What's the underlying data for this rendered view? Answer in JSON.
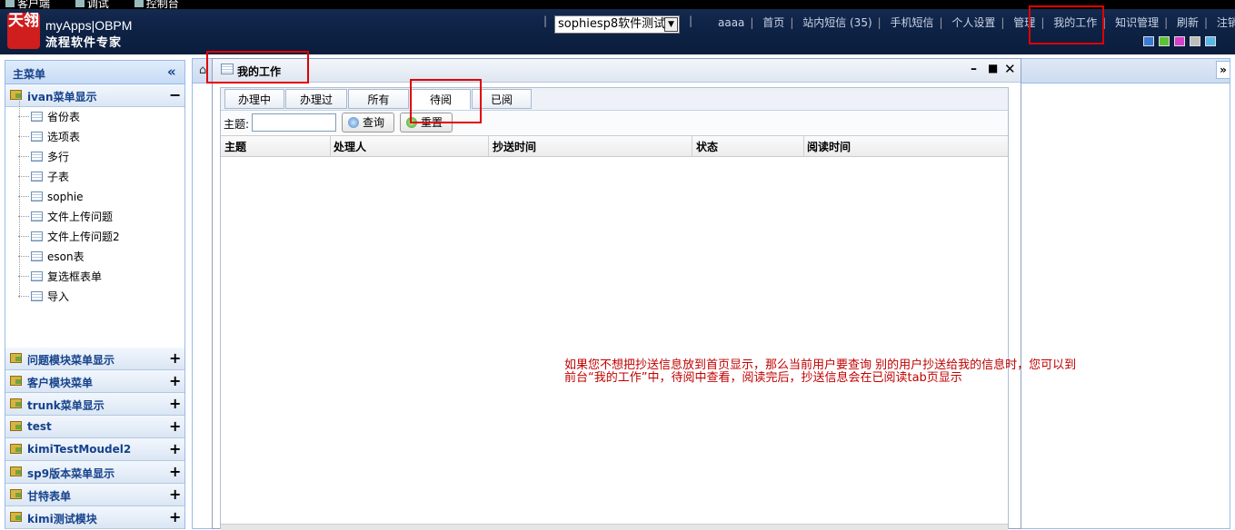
{
  "topbar": {
    "items": [
      "客户端",
      "调试",
      "控制台"
    ]
  },
  "brand": {
    "logo_mark": "天翎",
    "name": "myApps|OBPM",
    "tagline": "流程软件专家"
  },
  "app_select": {
    "value": "sophiesp8软件测试"
  },
  "nav": {
    "user": "aaaa",
    "items": [
      "首页",
      "站内短信 (35)",
      "手机短信",
      "个人设置",
      "管理",
      "我的工作",
      "知识管理",
      "刷新",
      "注销"
    ]
  },
  "theme_colors": [
    "#3a7bd5",
    "#5bc236",
    "#d63fc8",
    "#bdbdbd",
    "#5ab6e8"
  ],
  "sidebar": {
    "title": "主菜单",
    "collapse_glyph": "«",
    "open_group": {
      "label": "ivan菜单显示",
      "toggle": "−",
      "items": [
        "省份表",
        "选项表",
        "多行",
        "子表",
        "sophie",
        "文件上传问题",
        "文件上传问题2",
        "eson表",
        "复选框表单",
        "导入"
      ]
    },
    "groups": [
      {
        "label": "问题模块菜单显示",
        "toggle": "+"
      },
      {
        "label": "客户模块菜单",
        "toggle": "+"
      },
      {
        "label": "trunk菜单显示",
        "toggle": "+"
      },
      {
        "label": "test",
        "toggle": "+"
      },
      {
        "label": "kimiTestMoudel2",
        "toggle": "+"
      },
      {
        "label": "sp9版本菜单显示",
        "toggle": "+"
      },
      {
        "label": "甘特表单",
        "toggle": "+"
      },
      {
        "label": "kimi测试模块",
        "toggle": "+"
      }
    ]
  },
  "window": {
    "title": "我的工作",
    "tabs": [
      "办理中",
      "办理过",
      "所有",
      "待阅",
      "已阅"
    ],
    "active_tab": "待阅",
    "filter": {
      "subject_label": "主题:",
      "subject_value": "",
      "query_button": "查询",
      "reset_button": "重置"
    },
    "columns": [
      "主题",
      "处理人",
      "抄送时间",
      "状态",
      "阅读时间"
    ],
    "rows": []
  },
  "annotation": {
    "line1": "如果您不想把抄送信息放到首页显示，那么当前用户要查询 别的用户抄送给我的信息时，您可以到",
    "line2": "前台“我的工作”中，待阅中查看，阅读完后，抄送信息会在已阅读tab页显示"
  }
}
